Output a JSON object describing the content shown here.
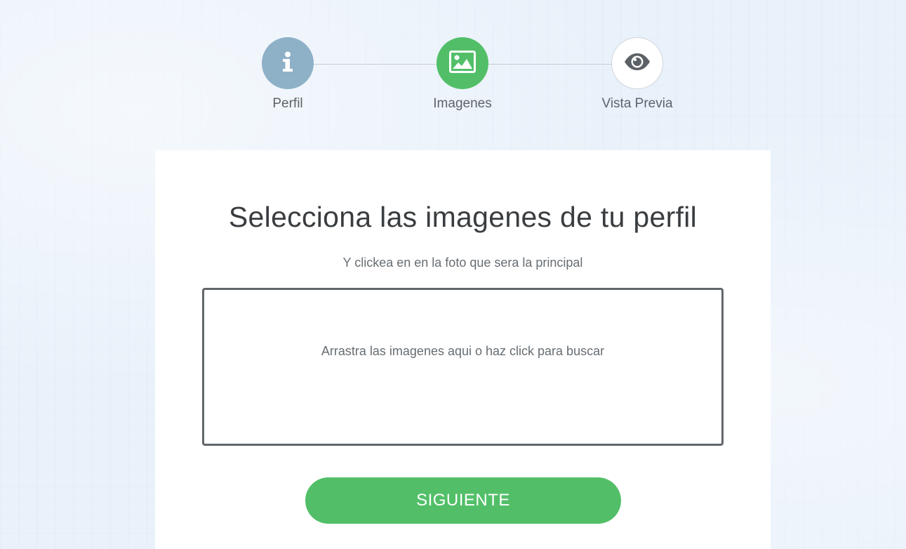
{
  "stepper": {
    "steps": [
      {
        "label": "Perfil",
        "icon": "info-icon",
        "color": "#8eb1c8"
      },
      {
        "label": "Imagenes",
        "icon": "image-icon",
        "color": "#52bf68"
      },
      {
        "label": "Vista Previa",
        "icon": "eye-icon",
        "color": "#ffffff"
      }
    ]
  },
  "main": {
    "title": "Selecciona las imagenes de tu perfil",
    "subtitle": "Y clickea en en la foto que sera la principal",
    "dropzone_text": "Arrastra las imagenes aqui o haz click para buscar",
    "next_label": "SIGUIENTE"
  },
  "colors": {
    "accent": "#52bf68",
    "info": "#8eb1c8",
    "text": "#3a3d40"
  }
}
